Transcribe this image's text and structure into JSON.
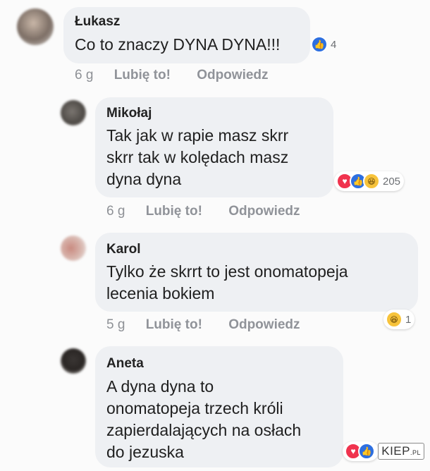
{
  "comments": [
    {
      "author": "Łukasz",
      "lines": [
        "Co to znaczy DYNA DYNA!!!"
      ],
      "time": "6 g",
      "like_label": "Lubię to!",
      "reply_label": "Odpowiedz",
      "reactions": [
        "like-icon"
      ],
      "reaction_count": "4"
    },
    {
      "author": "Mikołaj",
      "lines": [
        "Tak jak w rapie masz skrr",
        "skrr tak w kolędach masz",
        "dyna dyna"
      ],
      "time": "6 g",
      "like_label": "Lubię to!",
      "reply_label": "Odpowiedz",
      "reactions": [
        "love-icon",
        "like-icon",
        "haha-icon"
      ],
      "reaction_count": "205"
    },
    {
      "author": "Karol",
      "lines": [
        "Tylko że skrrt to jest onomatopeja",
        "lecenia bokiem"
      ],
      "time": "5 g",
      "like_label": "Lubię to!",
      "reply_label": "Odpowiedz",
      "reactions": [
        "haha-icon"
      ],
      "reaction_count": "1"
    },
    {
      "author": "Aneta",
      "lines": [
        "A dyna dyna to",
        "onomatopeja trzech króli",
        "zapierdalających na osłach",
        "do jezuska"
      ],
      "reactions": [
        "love-icon",
        "like-icon"
      ]
    }
  ],
  "watermark": {
    "main": "KIEP",
    "suffix": ".PL"
  },
  "colors": {
    "bubble": "#eef0f3",
    "like": "#2d6fe0",
    "love": "#f0334e",
    "haha": "#f7c33b",
    "meta": "#8e9196"
  }
}
